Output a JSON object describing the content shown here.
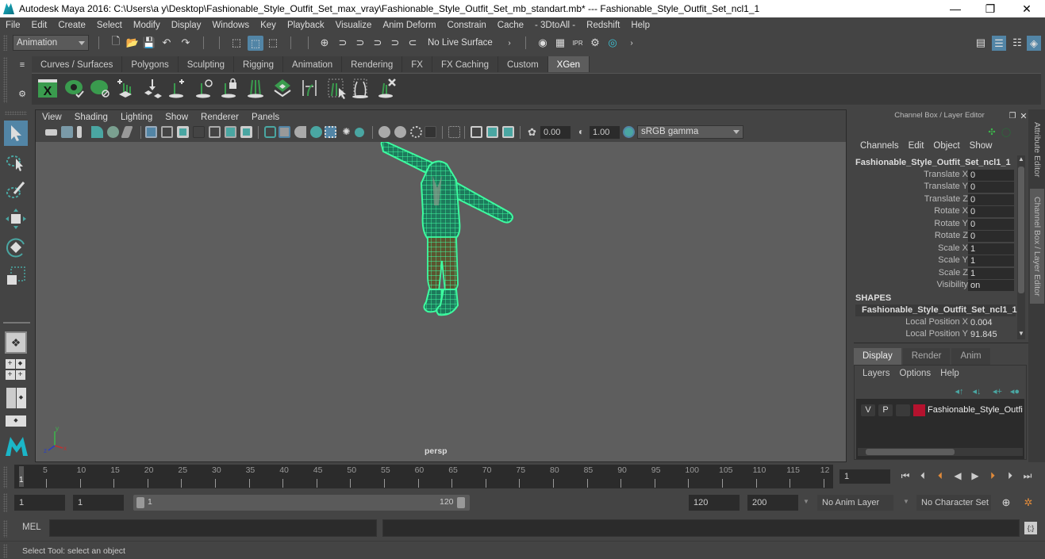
{
  "window": {
    "title": "Autodesk Maya 2016: C:\\Users\\a y\\Desktop\\Fashionable_Style_Outfit_Set_max_vray\\Fashionable_Style_Outfit_Set_mb_standart.mb*  ---  Fashionable_Style_Outfit_Set_ncl1_1",
    "controls": {
      "minimize": "—",
      "maximize": "❐",
      "close": "✕"
    }
  },
  "menubar": [
    "File",
    "Edit",
    "Create",
    "Select",
    "Modify",
    "Display",
    "Windows",
    "Key",
    "Playback",
    "Visualize",
    "Anim Deform",
    "Constrain",
    "Cache",
    "- 3DtoAll -",
    "Redshift",
    "Help"
  ],
  "statusline": {
    "menuset": "Animation",
    "live_surface": "No Live Surface"
  },
  "shelf": {
    "tabs": [
      "Curves / Surfaces",
      "Polygons",
      "Sculpting",
      "Rigging",
      "Animation",
      "Rendering",
      "FX",
      "FX Caching",
      "Custom",
      "XGen"
    ],
    "active_tab": "XGen",
    "icons": [
      "xgen-window-icon",
      "create-description-icon",
      "delete-description-icon",
      "add-guides-icon",
      "move-guides-icon",
      "add-primitive-icon",
      "rotate-guide-icon",
      "lock-guide-icon",
      "guide-length-icon",
      "modifier-patch-icon",
      "bend-guide-icon",
      "select-guide-icon",
      "sculpt-guide-icon",
      "delete-guide-icon"
    ]
  },
  "viewport": {
    "menu": [
      "View",
      "Shading",
      "Lighting",
      "Show",
      "Renderer",
      "Panels"
    ],
    "exposure": "0.00",
    "gamma": "1.00",
    "color_space": "sRGB gamma",
    "camera_label": "persp",
    "axis": {
      "x": "x",
      "y": "y",
      "z": "z"
    }
  },
  "channel_box": {
    "title": "Channel Box / Layer Editor",
    "menu": [
      "Channels",
      "Edit",
      "Object",
      "Show"
    ],
    "object_name": "Fashionable_Style_Outfit_Set_ncl1_1",
    "channels": [
      {
        "label": "Translate X",
        "value": "0"
      },
      {
        "label": "Translate Y",
        "value": "0"
      },
      {
        "label": "Translate Z",
        "value": "0"
      },
      {
        "label": "Rotate X",
        "value": "0"
      },
      {
        "label": "Rotate Y",
        "value": "0"
      },
      {
        "label": "Rotate Z",
        "value": "0"
      },
      {
        "label": "Scale X",
        "value": "1"
      },
      {
        "label": "Scale Y",
        "value": "1"
      },
      {
        "label": "Scale Z",
        "value": "1"
      },
      {
        "label": "Visibility",
        "value": "on"
      }
    ],
    "shapes_header": "SHAPES",
    "shape_name": "Fashionable_Style_Outfit_Set_ncl1_1...",
    "shape_channels": [
      {
        "label": "Local Position X",
        "value": "0.004"
      },
      {
        "label": "Local Position Y",
        "value": "91.845"
      }
    ]
  },
  "side_tabs": [
    "Attribute Editor",
    "Channel Box / Layer Editor"
  ],
  "layer_editor": {
    "tabs": [
      "Display",
      "Render",
      "Anim"
    ],
    "active_tab": "Display",
    "menu": [
      "Layers",
      "Options",
      "Help"
    ],
    "layers": [
      {
        "v": "V",
        "p": "P",
        "color": "#b5122e",
        "name": "Fashionable_Style_Outfit_Set"
      }
    ]
  },
  "timeline": {
    "tick_labels": [
      "5",
      "10",
      "15",
      "20",
      "25",
      "30",
      "35",
      "40",
      "45",
      "50",
      "55",
      "60",
      "65",
      "70",
      "75",
      "80",
      "85",
      "90",
      "95",
      "100",
      "105",
      "110",
      "115",
      "12"
    ],
    "current_frame_marker": "1",
    "current_frame": "1"
  },
  "range": {
    "start": "1",
    "playback_start": "1",
    "slider_min": "1",
    "slider_max": "120",
    "playback_end": "120",
    "end": "200",
    "anim_layer": "No Anim Layer",
    "character_set": "No Character Set"
  },
  "command_line": {
    "label": "MEL",
    "input": "",
    "output": ""
  },
  "help_line": "Select Tool: select an object",
  "colors": {
    "wire": "#3dfca0",
    "accent": "#5285a6",
    "layer": "#b5122e"
  }
}
